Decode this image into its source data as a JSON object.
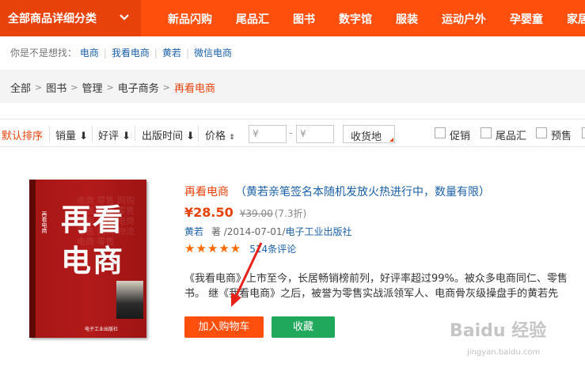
{
  "nav": {
    "all_categories": "全部商品详细分类",
    "items": [
      "新品闪购",
      "尾品汇",
      "图书",
      "数字馆",
      "服装",
      "运动户外",
      "孕婴童",
      "家居"
    ]
  },
  "suggest": {
    "label": "你是不是想找：",
    "links": [
      "电商",
      "我看电商",
      "黄若",
      "微信电商"
    ]
  },
  "breadcrumb": [
    "全部",
    "图书",
    "管理",
    "电子商务",
    "再看电商"
  ],
  "sortbar": {
    "default": "默认排序",
    "sales": "销量",
    "rating": "好评",
    "pubdate": "出版时间",
    "price": "价格",
    "price_min_placeholder": "¥",
    "price_max_placeholder": "¥",
    "price_dash": "-",
    "ship_to": "收货地",
    "filters": [
      "促销",
      "尾品汇",
      "预售"
    ]
  },
  "product": {
    "title": "再看电商",
    "subtitle": "（黄若亲笔签名本随机发放火热进行中，数量有限）",
    "price": "¥28.50",
    "old_price": "¥39.00",
    "discount": "(7.3折)",
    "author": "黄若",
    "author_role": "著",
    "date": "/2014-07-01",
    "publisher_sep": "/",
    "publisher": "电子工业出版社",
    "stars": "★★★★★",
    "rating": 5,
    "reviews": "514条评论",
    "desc_line1": "《我看电商》上市至今，长居畅销榜前列，好评率超过99%。被众多电商同仁、零售",
    "desc_line2": "书。 继《我看电商》之后，被誉为零售实战派领军人、电商骨灰级操盘手的黄若先",
    "add_to_cart": "加入购物车",
    "favorite": "收藏"
  },
  "cover": {
    "title_top": "再看",
    "title_bottom": "电商",
    "spine_text": "再看电商",
    "author": "黄若 著",
    "publisher": "电子工业出版社"
  },
  "watermark": {
    "logo": "Baidu 经验",
    "url": "jingyan.baidu.com"
  },
  "colors": {
    "brand": "#ff4f0d",
    "link": "#1a5fa8",
    "fav": "#20a85c"
  }
}
